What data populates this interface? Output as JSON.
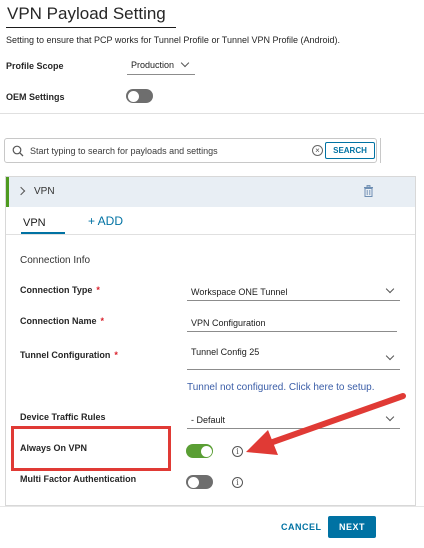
{
  "page": {
    "title": "VPN Payload Setting",
    "description": "Setting to ensure that PCP works for Tunnel Profile or Tunnel VPN Profile (Android)."
  },
  "profile_scope": {
    "label": "Profile Scope",
    "value": "Production"
  },
  "oem_settings": {
    "label": "OEM Settings",
    "enabled": false
  },
  "search": {
    "placeholder": "Start typing to search for payloads and settings",
    "button_label": "SEARCH"
  },
  "payload": {
    "name": "VPN",
    "tabs": [
      {
        "label": "VPN",
        "active": true
      },
      {
        "label": "+ ADD",
        "active": false
      }
    ],
    "section_title": "Connection Info",
    "fields": {
      "connection_type": {
        "label": "Connection Type",
        "required": "*",
        "value": "Workspace ONE Tunnel"
      },
      "connection_name": {
        "label": "Connection Name",
        "required": "*",
        "value": "VPN Configuration"
      },
      "tunnel_configuration": {
        "label": "Tunnel Configuration",
        "required": "*",
        "value": "Tunnel Config 25"
      },
      "tunnel_link": "Tunnel not configured. Click here to setup.",
      "device_traffic_rules": {
        "label": "Device Traffic Rules",
        "value": "- Default"
      },
      "always_on_vpn": {
        "label": "Always On VPN",
        "enabled": true
      },
      "multi_factor_auth": {
        "label": "Multi Factor Authentication",
        "enabled": false
      }
    }
  },
  "footer": {
    "cancel_label": "CANCEL",
    "next_label": "NEXT"
  },
  "colors": {
    "accent": "#0072a3",
    "toggle_on": "#5a9e34",
    "annotation": "#e03a35",
    "required": "#d9202b"
  },
  "icons": [
    "search-icon",
    "clear-icon",
    "chevron-down-icon",
    "chevron-right-icon",
    "trash-icon",
    "info-icon",
    "arrow-annotation"
  ]
}
